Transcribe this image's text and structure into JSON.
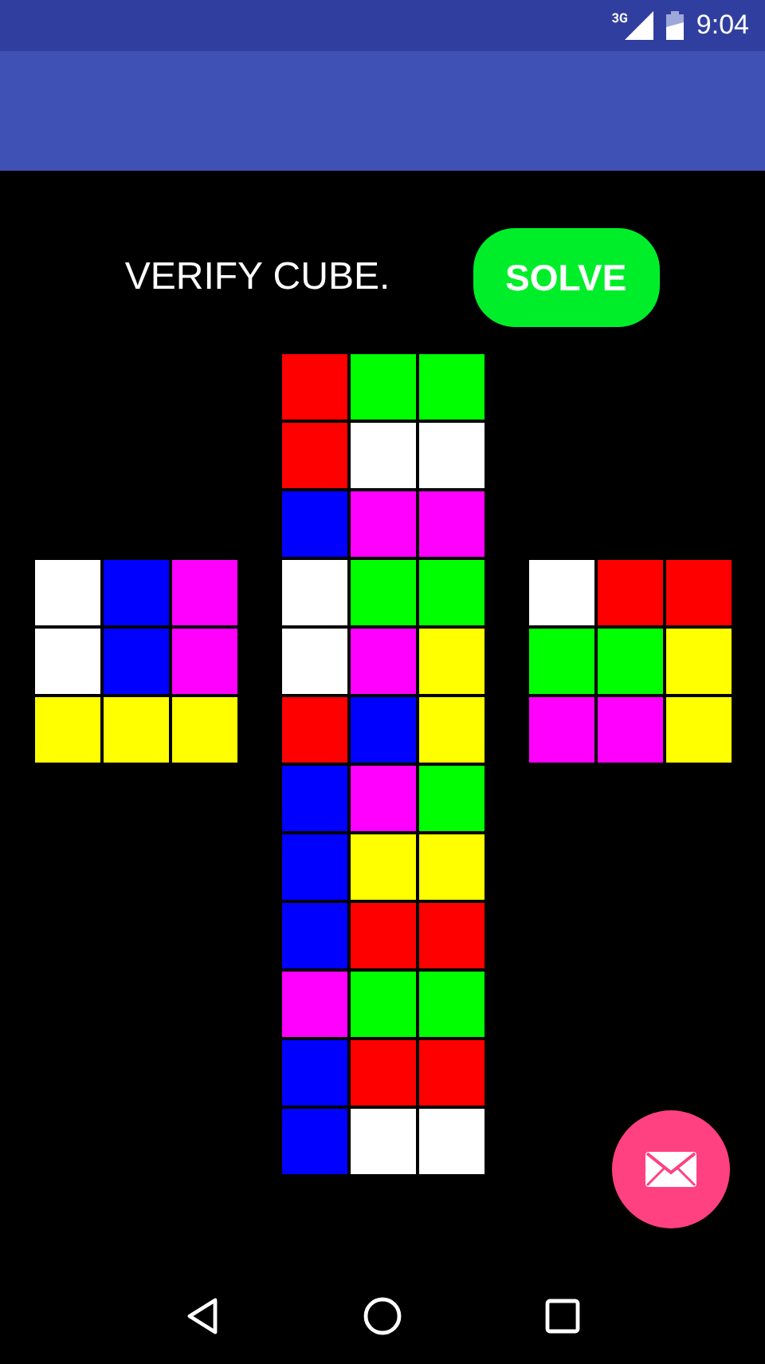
{
  "status_bar": {
    "network": "3G",
    "time": "9:04"
  },
  "prompt": "VERIFY CUBE.",
  "solve_button": "SOLVE",
  "cube": {
    "faces": [
      {
        "kind": "top",
        "stickers": [
          {
            "color": "#ff0000"
          },
          {
            "color": "#00ff00"
          },
          {
            "color": "#00ff00"
          },
          {
            "color": "#ff0000"
          },
          {
            "color": "#ffffff"
          },
          {
            "color": "#ffffff"
          },
          {
            "color": "#0000ff"
          },
          {
            "color": "#ff00ff"
          },
          {
            "color": "#ff00ff"
          }
        ]
      },
      {
        "kind": "left",
        "stickers": [
          {
            "color": "#ffffff"
          },
          {
            "color": "#0000ff"
          },
          {
            "color": "#ff00ff"
          },
          {
            "color": "#ffffff"
          },
          {
            "color": "#0000ff"
          },
          {
            "color": "#ff00ff"
          },
          {
            "color": "#ffff00"
          },
          {
            "color": "#ffff00"
          },
          {
            "color": "#ffff00"
          }
        ]
      },
      {
        "kind": "front",
        "stickers": [
          {
            "color": "#ffffff"
          },
          {
            "color": "#00ff00"
          },
          {
            "color": "#00ff00"
          },
          {
            "color": "#ffffff"
          },
          {
            "color": "#ff00ff"
          },
          {
            "color": "#ffff00"
          },
          {
            "color": "#ff0000"
          },
          {
            "color": "#0000ff"
          },
          {
            "color": "#ffff00"
          }
        ]
      },
      {
        "kind": "right",
        "stickers": [
          {
            "color": "#ffffff"
          },
          {
            "color": "#ff0000"
          },
          {
            "color": "#ff0000"
          },
          {
            "color": "#00ff00"
          },
          {
            "color": "#00ff00"
          },
          {
            "color": "#ffff00"
          },
          {
            "color": "#ff00ff"
          },
          {
            "color": "#ff00ff"
          },
          {
            "color": "#ffff00"
          }
        ]
      },
      {
        "kind": "bottom",
        "stickers": [
          {
            "color": "#0000ff"
          },
          {
            "color": "#ff00ff"
          },
          {
            "color": "#00ff00"
          },
          {
            "color": "#0000ff"
          },
          {
            "color": "#ffff00"
          },
          {
            "color": "#ffff00"
          },
          {
            "color": "#0000ff"
          },
          {
            "color": "#ff0000"
          },
          {
            "color": "#ff0000"
          }
        ]
      },
      {
        "kind": "back",
        "stickers": [
          {
            "color": "#ff00ff"
          },
          {
            "color": "#00ff00"
          },
          {
            "color": "#00ff00"
          },
          {
            "color": "#0000ff"
          },
          {
            "color": "#ff0000"
          },
          {
            "color": "#ff0000"
          },
          {
            "color": "#0000ff"
          },
          {
            "color": "#ffffff"
          },
          {
            "color": "#ffffff"
          }
        ]
      }
    ]
  }
}
